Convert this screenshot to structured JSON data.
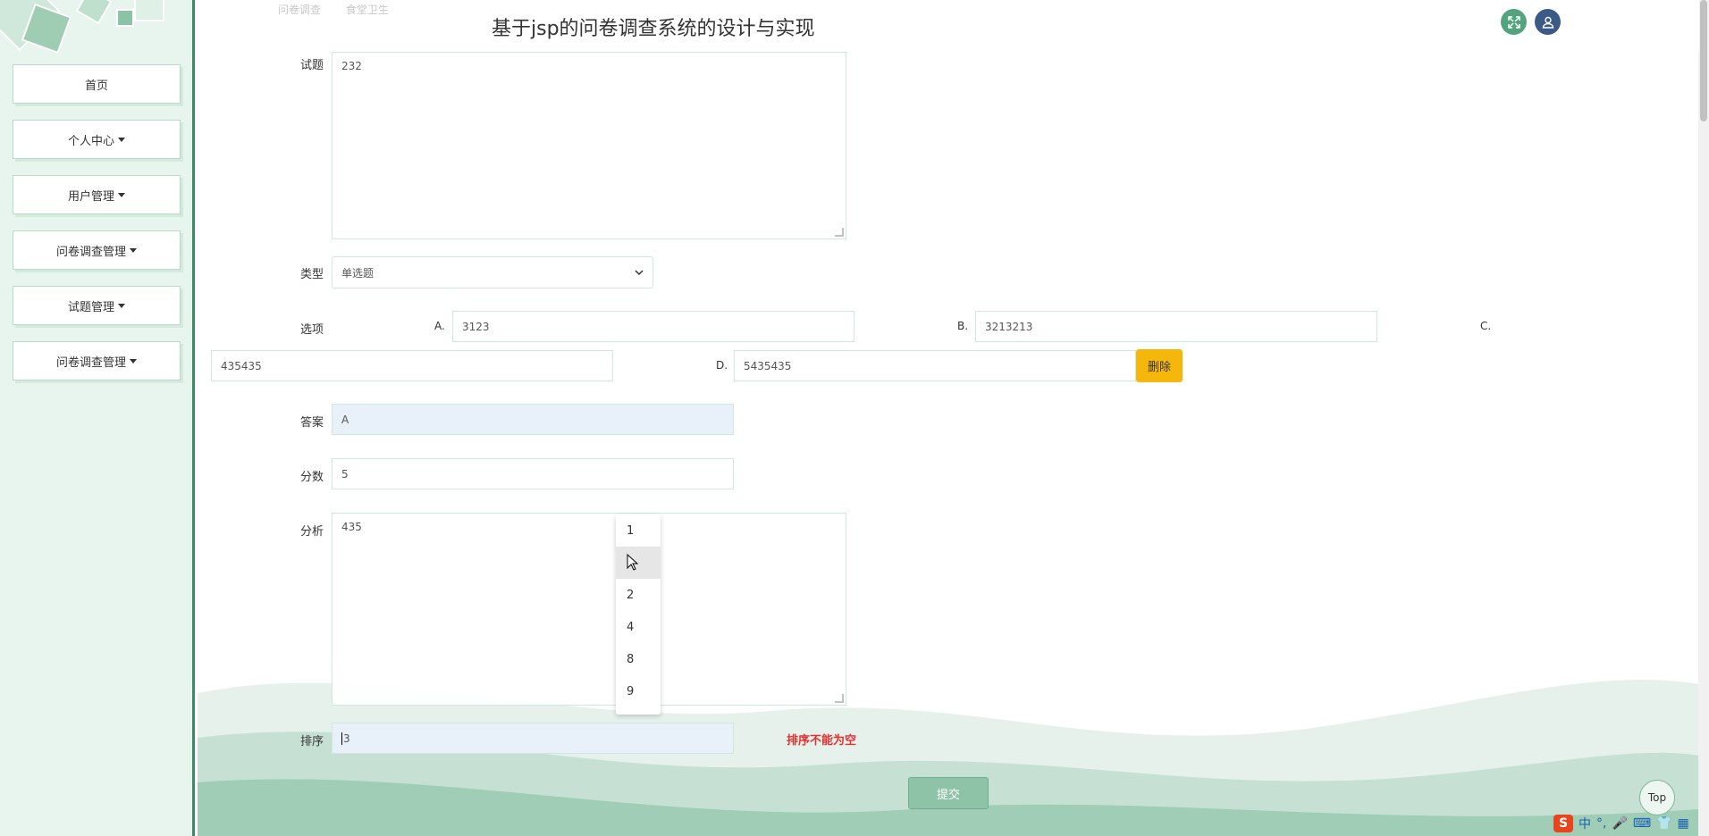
{
  "app": {
    "title": "基于jsp的问卷调查系统的设计与实现"
  },
  "breadcrumb": {
    "items": [
      "问卷调查",
      "食堂卫生"
    ]
  },
  "sidebar": {
    "items": [
      {
        "label": "首页"
      },
      {
        "label": "个人中心"
      },
      {
        "label": "用户管理"
      },
      {
        "label": "问卷调查管理"
      },
      {
        "label": "试题管理"
      },
      {
        "label": "问卷调查管理"
      }
    ]
  },
  "form": {
    "question_label": "试题",
    "question_value": "232",
    "type_label": "类型",
    "type_value": "单选题",
    "options_label": "选项",
    "options": [
      {
        "letter": "A.",
        "value": "3123"
      },
      {
        "letter": "B.",
        "value": "3213213"
      },
      {
        "letter": "C.",
        "value": "435435"
      },
      {
        "letter": "D.",
        "value": "5435435"
      }
    ],
    "delete_label": "删除",
    "answer_label": "答案",
    "answer_value": "A",
    "score_label": "分数",
    "score_value": "5",
    "analysis_label": "分析",
    "analysis_value": "435",
    "sort_label": "排序",
    "sort_value": "3",
    "sort_error": "排序不能为空",
    "submit_label": "提交"
  },
  "sort_dropdown": {
    "items": [
      "1",
      "",
      "2",
      "4",
      "8",
      "9"
    ]
  },
  "top_button": "Top",
  "tray": {
    "ime": "中"
  },
  "colors": {
    "accent": "#3a8a65",
    "sidebar_bg": "#e8f5ee",
    "delete": "#f5b70c",
    "error": "#e03030",
    "avatar": "#3b5a86",
    "fullscreen": "#52a37e"
  }
}
